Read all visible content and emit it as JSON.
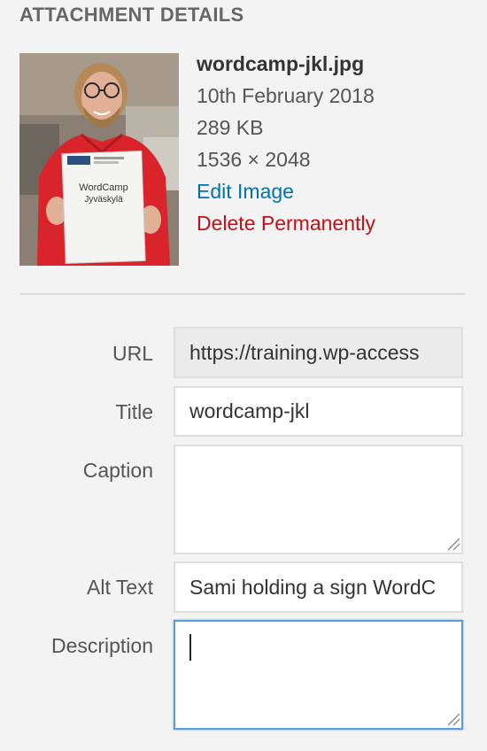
{
  "header": {
    "title": "ATTACHMENT DETAILS"
  },
  "thumbnail": {
    "icon": "photo-thumbnail",
    "sign_text_line1": "WordCamp",
    "sign_text_line2": "Jyväskylä"
  },
  "details": {
    "filename": "wordcamp-jkl.jpg",
    "date": "10th February 2018",
    "filesize": "289 KB",
    "dimensions": "1536 × 2048",
    "edit_label": "Edit Image",
    "delete_label": "Delete Permanently"
  },
  "fields": {
    "url": {
      "label": "URL",
      "value": "https://training.wp-access"
    },
    "title": {
      "label": "Title",
      "value": "wordcamp-jkl"
    },
    "caption": {
      "label": "Caption",
      "value": ""
    },
    "alt": {
      "label": "Alt Text",
      "value": "Sami holding a sign WordC"
    },
    "description": {
      "label": "Description",
      "value": ""
    }
  },
  "colors": {
    "link": "#0073aa",
    "delete": "#c0111b",
    "focus_border": "#5b9dd9"
  }
}
